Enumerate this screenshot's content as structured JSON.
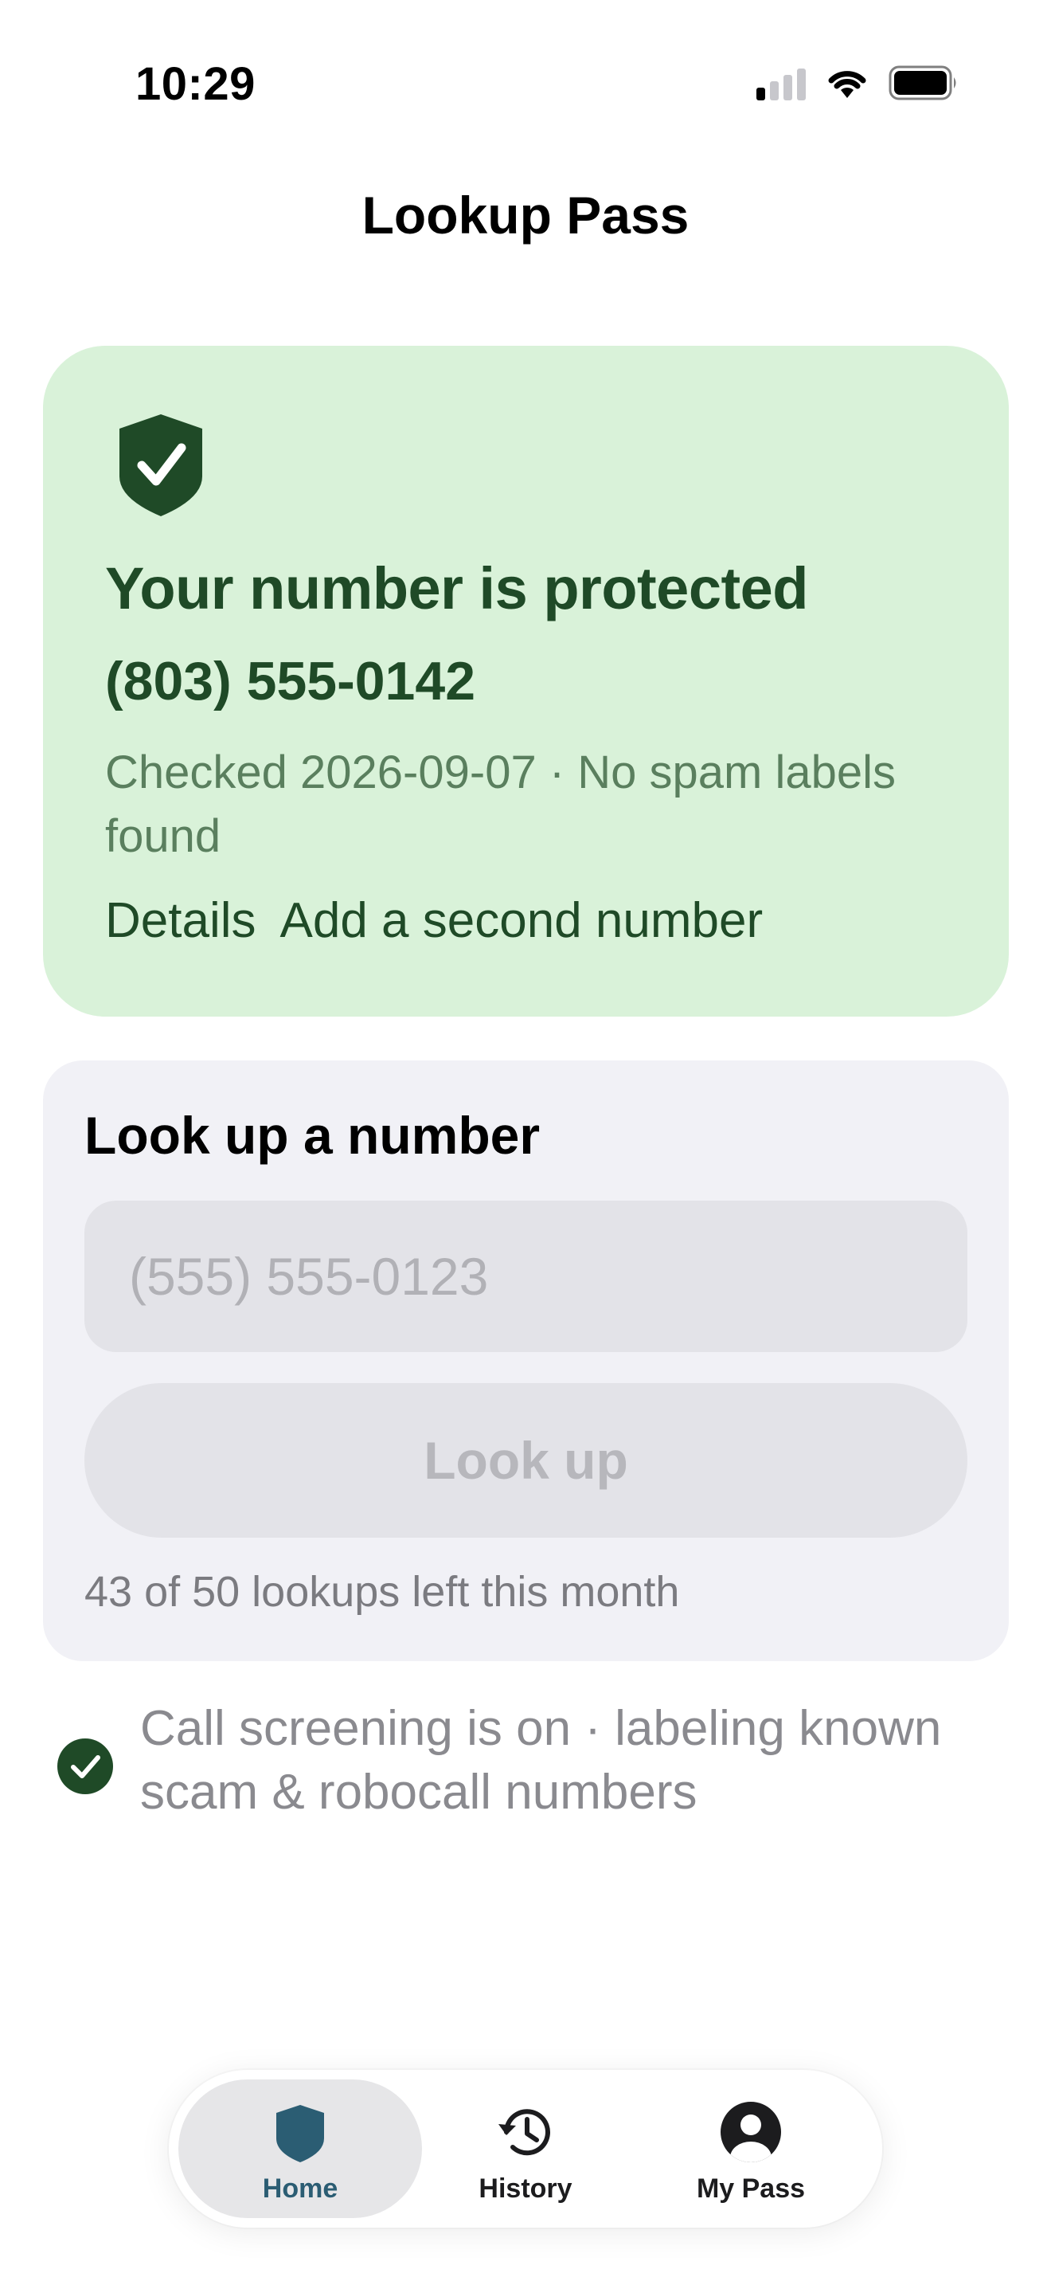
{
  "status_bar": {
    "time": "10:29",
    "signal_icon": "cellular-signal-icon",
    "wifi_icon": "wifi-icon",
    "battery_icon": "battery-icon"
  },
  "nav": {
    "title": "Lookup Pass"
  },
  "protection": {
    "icon": "shield-check-icon",
    "title": "Your number is protected",
    "number": "(803) 555-0142",
    "meta": "Checked 2026-09-07 · No spam labels found",
    "links": {
      "details": "Details",
      "add_second": "Add a second number"
    },
    "colors": {
      "background": "#d9f2d9",
      "text": "#1f4a27"
    }
  },
  "lookup": {
    "title": "Look up a number",
    "input_placeholder": "(555) 555-0123",
    "input_value": "",
    "button_label": "Look up",
    "quota_text": "43 of 50 lookups left this month"
  },
  "screening": {
    "icon": "checkmark-circle-icon",
    "text": "Call screening is on · labeling known scam & robocall numbers"
  },
  "tab_bar": {
    "tabs": [
      {
        "label": "Home",
        "icon": "shield-icon",
        "active": true
      },
      {
        "label": "History",
        "icon": "history-clock-icon",
        "active": false
      },
      {
        "label": "My Pass",
        "icon": "person-circle-icon",
        "active": false
      }
    ],
    "accent": "#2b5d73"
  }
}
